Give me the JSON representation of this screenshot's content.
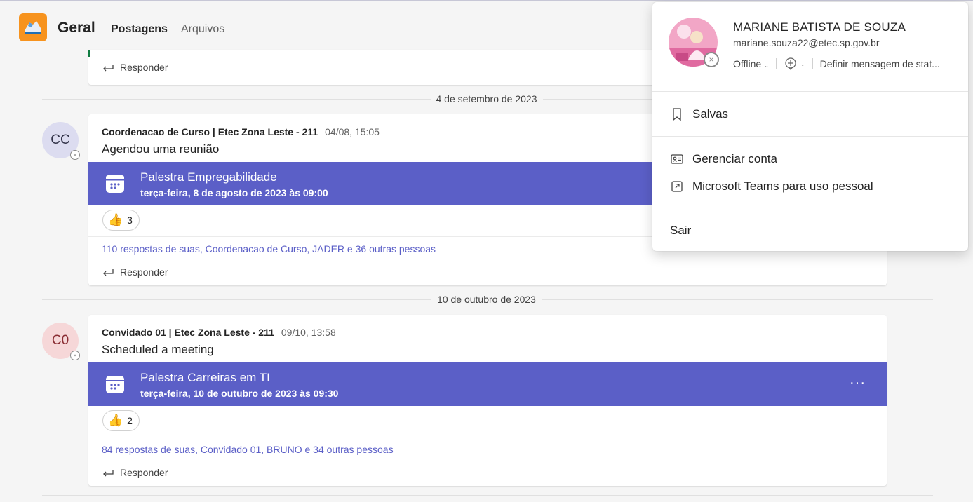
{
  "header": {
    "channel": "Geral",
    "tabs": [
      {
        "label": "Postagens",
        "active": true
      },
      {
        "label": "Arquivos",
        "active": false
      }
    ],
    "logo_color": "#f7931e"
  },
  "colors": {
    "accent": "#5b5fc7",
    "meeting_banner": "#5b5fc7"
  },
  "feed": {
    "top_reply": "Responder",
    "dates": [
      "4 de setembro de 2023",
      "10 de outubro de 2023"
    ],
    "posts": [
      {
        "avatar_initials": "CC",
        "author": "Coordenacao de Curso | Etec Zona Leste - 211",
        "timestamp": "04/08, 15:05",
        "message": "Agendou uma reunião",
        "meeting_title": "Palestra Empregabilidade",
        "meeting_date": "terça-feira, 8 de agosto de 2023 às 09:00",
        "reaction_count": "3",
        "replies": "110 respostas de suas, Coordenacao de Curso, JADER e 36 outras pessoas",
        "reply_label": "Responder"
      },
      {
        "avatar_initials": "C0",
        "author": "Convidado 01 | Etec Zona Leste - 211",
        "timestamp": "09/10, 13:58",
        "message": "Scheduled a meeting",
        "meeting_title": "Palestra Carreiras em TI",
        "meeting_date": "terça-feira, 10 de outubro de 2023 às 09:30",
        "more": "···",
        "reaction_count": "2",
        "replies": "84 respostas de suas, Convidado 01, BRUNO e 34 outras pessoas",
        "reply_label": "Responder"
      }
    ]
  },
  "profile": {
    "name": "MARIANE BATISTA DE SOUZA",
    "email": "mariane.souza22@etec.sp.gov.br",
    "status": "Offline",
    "status_message": "Definir mensagem de stat...",
    "menu": [
      "Salvas",
      "Gerenciar conta",
      "Microsoft Teams para uso pessoal",
      "Sair"
    ]
  }
}
